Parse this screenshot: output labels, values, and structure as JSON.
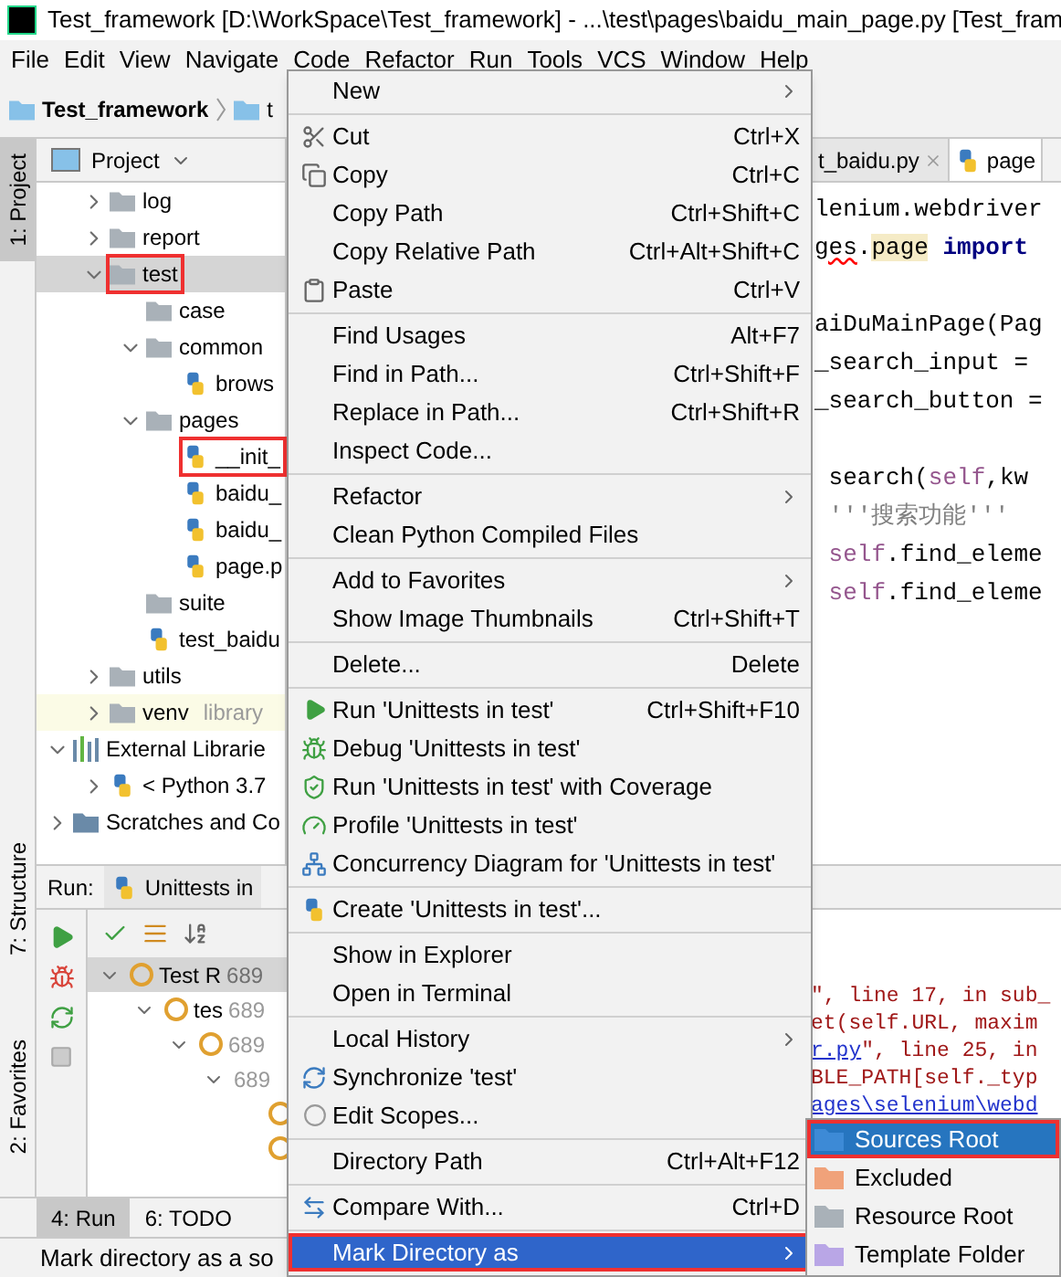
{
  "window": {
    "title": "Test_framework [D:\\WorkSpace\\Test_framework] - ...\\test\\pages\\baidu_main_page.py [Test_fram"
  },
  "menu_bar": [
    "File",
    "Edit",
    "View",
    "Navigate",
    "Code",
    "Refactor",
    "Run",
    "Tools",
    "VCS",
    "Window",
    "Help"
  ],
  "breadcrumb": [
    "Test_framework",
    "t"
  ],
  "side_tabs": [
    {
      "label": "1: Project",
      "selected": true
    },
    {
      "label": "7: Structure",
      "selected": false
    },
    {
      "label": "2: Favorites",
      "selected": false
    }
  ],
  "project_panel": {
    "title": "Project",
    "tree": [
      {
        "label": "log",
        "kind": "folder",
        "expanded": false
      },
      {
        "label": "report",
        "kind": "folder",
        "expanded": false
      },
      {
        "label": "test",
        "kind": "folder",
        "expanded": true,
        "selected": true,
        "highlighted": true,
        "children": [
          {
            "label": "case",
            "kind": "folder"
          },
          {
            "label": "common",
            "kind": "folder",
            "expanded": true,
            "children": [
              {
                "label": "brows",
                "kind": "file"
              }
            ]
          },
          {
            "label": "pages",
            "kind": "folder",
            "expanded": true,
            "children": [
              {
                "label": "__init_",
                "kind": "file",
                "highlighted": true
              },
              {
                "label": "baidu_",
                "kind": "file"
              },
              {
                "label": "baidu_",
                "kind": "file"
              },
              {
                "label": "page.p",
                "kind": "file"
              }
            ]
          },
          {
            "label": "suite",
            "kind": "folder"
          },
          {
            "label": "test_baidu",
            "kind": "file"
          }
        ]
      },
      {
        "label": "utils",
        "kind": "folder",
        "expanded": false
      },
      {
        "label": "venv",
        "kind": "folder",
        "expanded": false,
        "note": "library"
      },
      {
        "label": "External Librarie",
        "kind": "library",
        "expanded": true,
        "children": [
          {
            "label": "< Python 3.7",
            "kind": "python",
            "expanded": false
          }
        ]
      },
      {
        "label": "Scratches and Co",
        "kind": "scratches",
        "expanded": false
      }
    ]
  },
  "editor": {
    "tabs": [
      {
        "label": "t_baidu.py",
        "selected": false
      },
      {
        "label": "page",
        "selected": true
      }
    ],
    "lines": [
      {
        "segments": [
          {
            "text": "lenium.webdriver",
            "kind": "plain"
          }
        ]
      },
      {
        "segments": [
          {
            "text": "ges",
            "kind": "error"
          },
          {
            "text": ".",
            "kind": "plain"
          },
          {
            "text": "page",
            "kind": "mark"
          },
          {
            "text": " import",
            "kind": "keyword"
          }
        ]
      },
      {
        "segments": [
          {
            "text": "aiDuMainPage(Pag",
            "kind": "plain"
          }
        ]
      },
      {
        "segments": [
          {
            "text": "_search_input =",
            "kind": "plain"
          }
        ]
      },
      {
        "segments": [
          {
            "text": "_search_button =",
            "kind": "plain"
          }
        ]
      },
      {
        "segments": [
          {
            "text": " search(",
            "kind": "plain"
          },
          {
            "text": "self",
            "kind": "self"
          },
          {
            "text": ",kw",
            "kind": "plain"
          }
        ]
      },
      {
        "segments": [
          {
            "text": " '''搜索功能'''",
            "kind": "doc"
          }
        ]
      },
      {
        "segments": [
          {
            "text": " self",
            "kind": "self"
          },
          {
            "text": ".find_eleme",
            "kind": "plain"
          }
        ]
      },
      {
        "segments": [
          {
            "text": " self",
            "kind": "self"
          },
          {
            "text": ".find_eleme",
            "kind": "plain"
          }
        ]
      }
    ]
  },
  "run_panel": {
    "label": "Run:",
    "tab": "Unittests in",
    "tests": [
      {
        "name": "Test R",
        "time": "689",
        "failed": true,
        "expanded": true,
        "children": [
          {
            "name": "tes",
            "time": "689",
            "failed": true,
            "expanded": true,
            "children": [
              {
                "time": "689",
                "failed": true,
                "expanded": true,
                "children": [
                  {
                    "time": "689",
                    "expanded": true,
                    "children": [
                      {
                        "failed": true
                      },
                      {
                        "failed": true
                      }
                    ]
                  }
                ]
              }
            ]
          }
        ]
      }
    ],
    "console": [
      [
        {
          "text": "\", line 17, in sub_",
          "kind": "error"
        }
      ],
      [
        {
          "text": "et(self.URL, maxim",
          "kind": "error"
        }
      ],
      [
        {
          "text": "r.py",
          "kind": "link"
        },
        {
          "text": "\", line 25, in",
          "kind": "error"
        }
      ],
      [
        {
          "text": "BLE_PATH[self._typ",
          "kind": "error"
        }
      ],
      [
        {
          "text": "ages\\selenium\\webd",
          "kind": "link"
        }
      ]
    ]
  },
  "bottom_tabs": [
    {
      "label": "4: Run",
      "selected": true
    },
    {
      "label": "6: TODO",
      "selected": false
    }
  ],
  "status_bar": "Mark directory as a so",
  "context_menu": {
    "groups": [
      [
        {
          "label": "New",
          "submenu": true,
          "selected": false
        }
      ],
      [
        {
          "label": "Cut",
          "shortcut": "Ctrl+X",
          "selected": false
        },
        {
          "label": "Copy",
          "shortcut": "Ctrl+C",
          "selected": false
        },
        {
          "label": "Copy Path",
          "shortcut": "Ctrl+Shift+C",
          "selected": false
        },
        {
          "label": "Copy Relative Path",
          "shortcut": "Ctrl+Alt+Shift+C",
          "selected": false
        },
        {
          "label": "Paste",
          "shortcut": "Ctrl+V",
          "selected": false
        }
      ],
      [
        {
          "label": "Find Usages",
          "shortcut": "Alt+F7",
          "selected": false
        },
        {
          "label": "Find in Path...",
          "shortcut": "Ctrl+Shift+F",
          "selected": false
        },
        {
          "label": "Replace in Path...",
          "shortcut": "Ctrl+Shift+R",
          "selected": false
        },
        {
          "label": "Inspect Code...",
          "selected": false
        }
      ],
      [
        {
          "label": "Refactor",
          "submenu": true,
          "selected": false
        },
        {
          "label": "Clean Python Compiled Files",
          "selected": false
        }
      ],
      [
        {
          "label": "Add to Favorites",
          "submenu": true,
          "selected": false
        },
        {
          "label": "Show Image Thumbnails",
          "shortcut": "Ctrl+Shift+T",
          "selected": false
        }
      ],
      [
        {
          "label": "Delete...",
          "shortcut": "Delete",
          "selected": false
        }
      ],
      [
        {
          "label": "Run 'Unittests in test'",
          "shortcut": "Ctrl+Shift+F10",
          "selected": false
        },
        {
          "label": "Debug 'Unittests in test'",
          "selected": false
        },
        {
          "label": "Run 'Unittests in test' with Coverage",
          "selected": false
        },
        {
          "label": "Profile 'Unittests in test'",
          "selected": false
        },
        {
          "label": "Concurrency Diagram for 'Unittests in test'",
          "selected": false
        }
      ],
      [
        {
          "label": "Create 'Unittests in test'...",
          "selected": false
        }
      ],
      [
        {
          "label": "Show in Explorer",
          "selected": false
        },
        {
          "label": "Open in Terminal",
          "selected": false
        }
      ],
      [
        {
          "label": "Local History",
          "submenu": true,
          "selected": false
        },
        {
          "label": "Synchronize 'test'",
          "selected": false
        },
        {
          "label": "Edit Scopes...",
          "selected": false
        }
      ],
      [
        {
          "label": "Directory Path",
          "shortcut": "Ctrl+Alt+F12",
          "selected": false
        }
      ],
      [
        {
          "label": "Compare With...",
          "shortcut": "Ctrl+D",
          "selected": false
        }
      ],
      [
        {
          "label": "Mark Directory as",
          "submenu": true,
          "selected": true,
          "highlighted": true
        }
      ]
    ]
  },
  "submenu": [
    {
      "label": "Sources Root",
      "color": "#3d8ad6",
      "selected": true,
      "highlighted": true
    },
    {
      "label": "Excluded",
      "color": "#f0a27a",
      "selected": false
    },
    {
      "label": "Resource Root",
      "color": "#a9b1b8",
      "selected": false
    },
    {
      "label": "Template Folder",
      "color": "#b9a6e6",
      "selected": false
    }
  ]
}
